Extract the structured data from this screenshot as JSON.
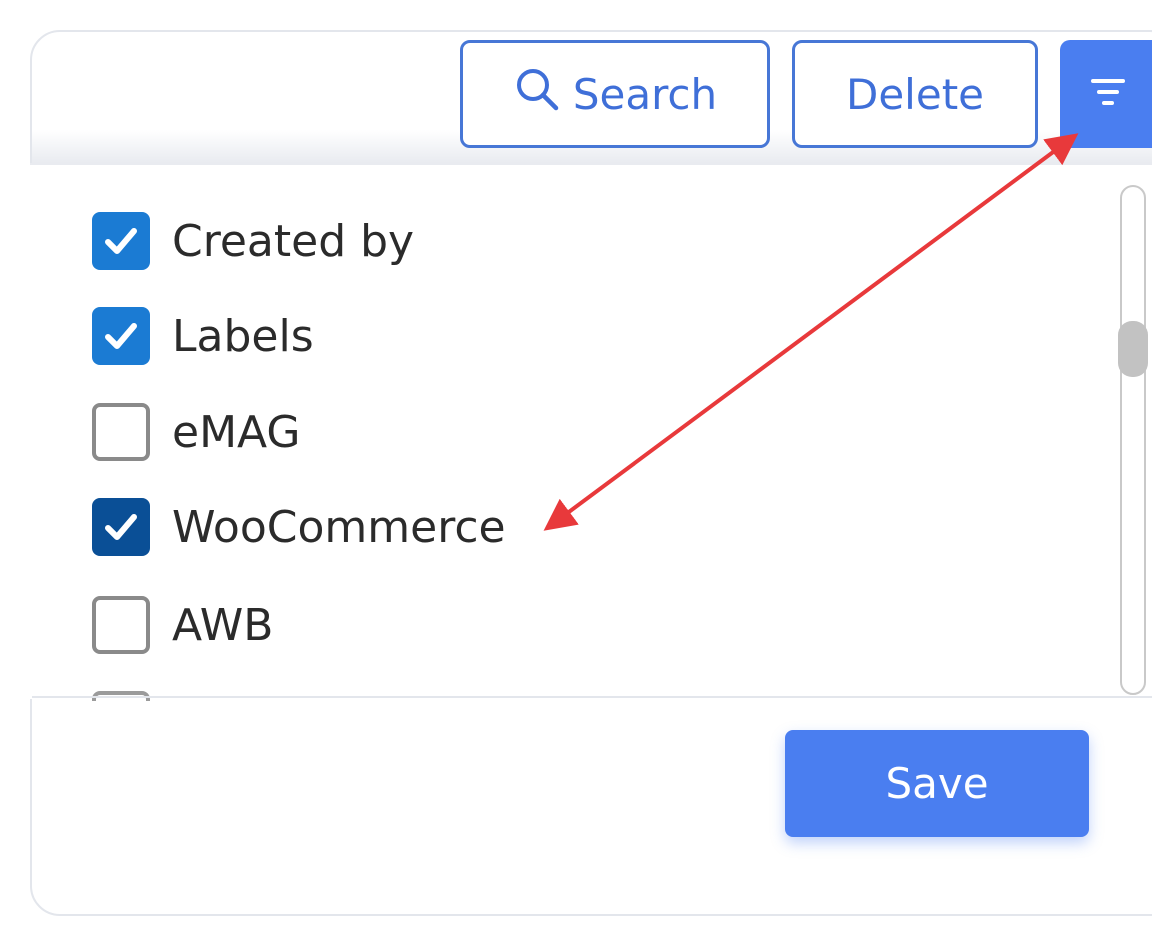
{
  "toolbar": {
    "search_label": "Search",
    "delete_label": "Delete"
  },
  "columns_menu": {
    "options": [
      {
        "label": "Created by",
        "checked": true
      },
      {
        "label": "Labels",
        "checked": true
      },
      {
        "label": "eMAG",
        "checked": false
      },
      {
        "label": "WooCommerce",
        "checked": true
      },
      {
        "label": "AWB",
        "checked": false
      }
    ],
    "save_label": "Save"
  },
  "colors": {
    "accent": "#4a7ef0",
    "outline": "#4777d6",
    "checkbox_checked": "#1b7bd3",
    "checkbox_checked_dark": "#0a4f96",
    "annotation_arrow": "#e8393b"
  },
  "icons": {
    "search": "search-icon",
    "filter": "filter-icon",
    "check": "checkmark-icon"
  }
}
